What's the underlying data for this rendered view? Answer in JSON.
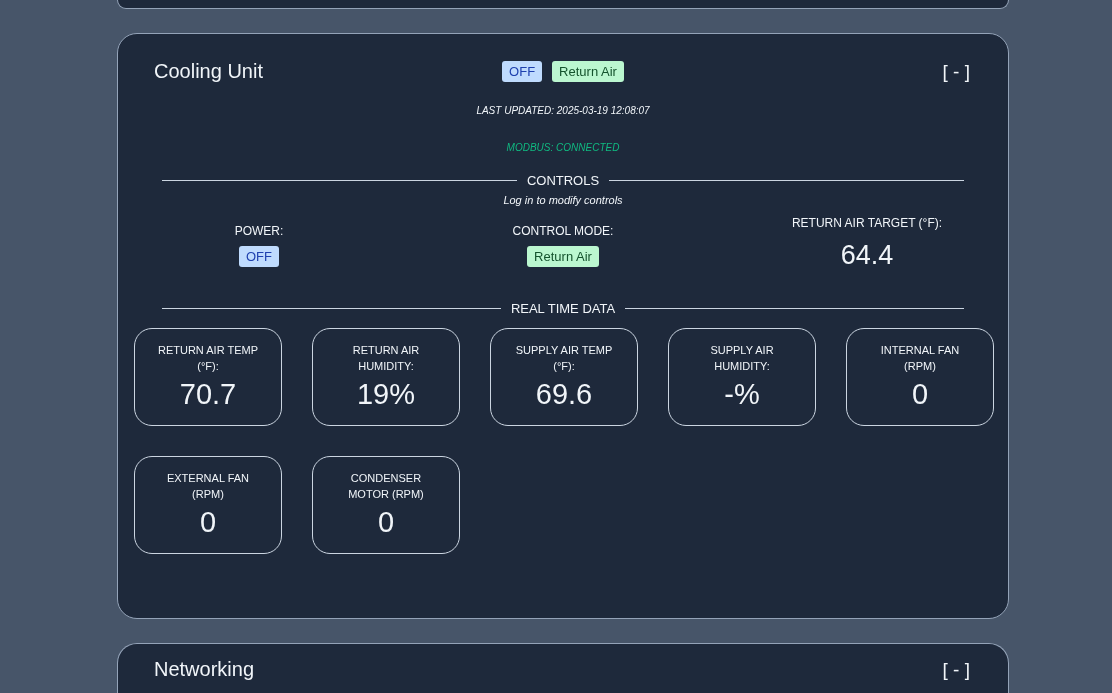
{
  "cooling_unit": {
    "title": "Cooling Unit",
    "badges": [
      {
        "text": "OFF",
        "kind": "power"
      },
      {
        "text": "Return Air",
        "kind": "mode"
      }
    ],
    "collapse": "[ - ]",
    "last_updated": "LAST UPDATED:  2025-03-19 12:08:07",
    "modbus_status": "MODBUS: CONNECTED",
    "controls": {
      "heading": "CONTROLS",
      "note": "Log in to modify controls",
      "items": [
        {
          "label": "POWER:",
          "kind": "power",
          "value": "OFF"
        },
        {
          "label": "CONTROL MODE:",
          "kind": "mode",
          "value": "Return Air"
        },
        {
          "label": "RETURN AIR TARGET (°F):",
          "kind": "number",
          "value": "64.4"
        }
      ]
    },
    "real_time_data": {
      "heading": "REAL TIME DATA",
      "metrics": [
        {
          "label": "RETURN AIR TEMP (°F):",
          "value": "70.7"
        },
        {
          "label": "RETURN AIR HUMIDITY:",
          "value": "19%"
        },
        {
          "label": "SUPPLY AIR TEMP (°F):",
          "value": "69.6"
        },
        {
          "label": "SUPPLY AIR HUMIDITY:",
          "value": "-%"
        },
        {
          "label": "INTERNAL FAN (RPM)",
          "value": "0"
        },
        {
          "label": "EXTERNAL FAN (RPM)",
          "value": "0"
        },
        {
          "label": "CONDENSER MOTOR (RPM)",
          "value": "0"
        }
      ]
    }
  },
  "networking": {
    "title": "Networking",
    "collapse": "[ - ]"
  }
}
